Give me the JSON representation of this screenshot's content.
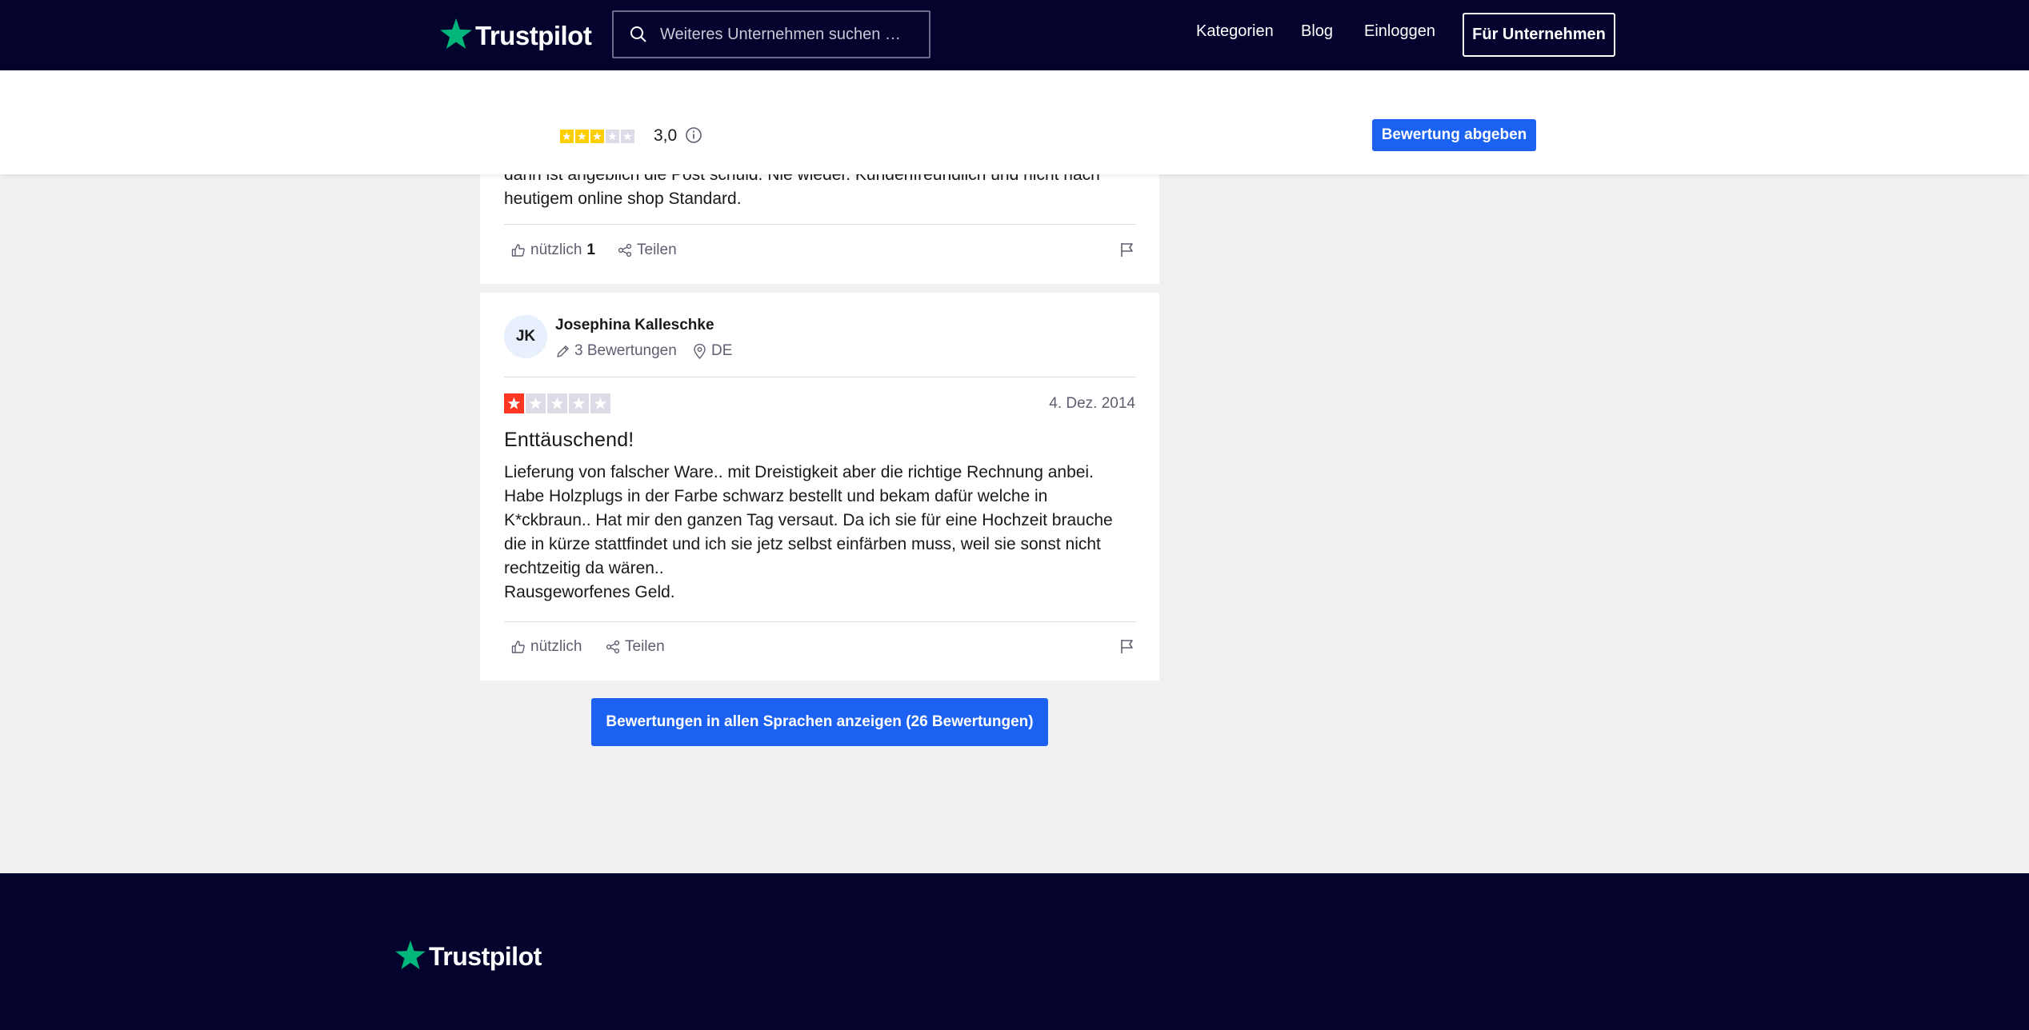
{
  "header": {
    "logo_text": "Trustpilot",
    "search_placeholder": "Weiteres Unternehmen suchen …",
    "nav": [
      "Kategorien",
      "Blog",
      "Einloggen"
    ],
    "business_button": "Für Unternehmen"
  },
  "subheader": {
    "rating_value": "3,0",
    "star_rating": 3,
    "write_review_button": "Bewertung abgeben"
  },
  "reviews": [
    {
      "text_lines": [
        "dann ist angeblich die Post schuld. Nie wieder. Kundenfreundlich und nicht nach",
        "heutigem online shop Standard."
      ],
      "useful_label": "nützlich",
      "useful_count": "1",
      "share_label": "Teilen"
    },
    {
      "initials": "JK",
      "name": "Josephina Kalleschke",
      "review_count": "3 Bewertungen",
      "country": "DE",
      "stars": 1,
      "date": "4. Dez. 2014",
      "title": "Enttäuschend!",
      "text_lines": [
        "Lieferung von falscher Ware.. mit Dreistigkeit aber die richtige Rechnung anbei.",
        "Habe Holzplugs in der Farbe schwarz bestellt und bekam dafür welche in",
        "K*ckbraun.. Hat mir den ganzen Tag versaut. Da ich sie für eine Hochzeit brauche",
        "die in kürze stattfindet und ich sie jetz selbst einfärben muss, weil sie sonst nicht",
        "rechtzeitig da wären..",
        "Rausgeworfenes Geld."
      ],
      "useful_label": "nützlich",
      "share_label": "Teilen"
    }
  ],
  "all_languages_button": "Bewertungen in allen Sprachen anzeigen (26 Bewertungen)",
  "footer": {
    "logo_text": "Trustpilot"
  },
  "colors": {
    "navy": "#04032d",
    "brand_green": "#00b67a",
    "accent_blue": "#1c62f2",
    "star_yellow": "#ffce00",
    "star_red": "#ff3722",
    "star_empty": "#dcdce6"
  },
  "icons": [
    "trustpilot-star-icon",
    "search-icon",
    "info-icon",
    "thumbs-up-icon",
    "share-icon",
    "flag-icon",
    "pencil-icon",
    "location-pin-icon"
  ]
}
